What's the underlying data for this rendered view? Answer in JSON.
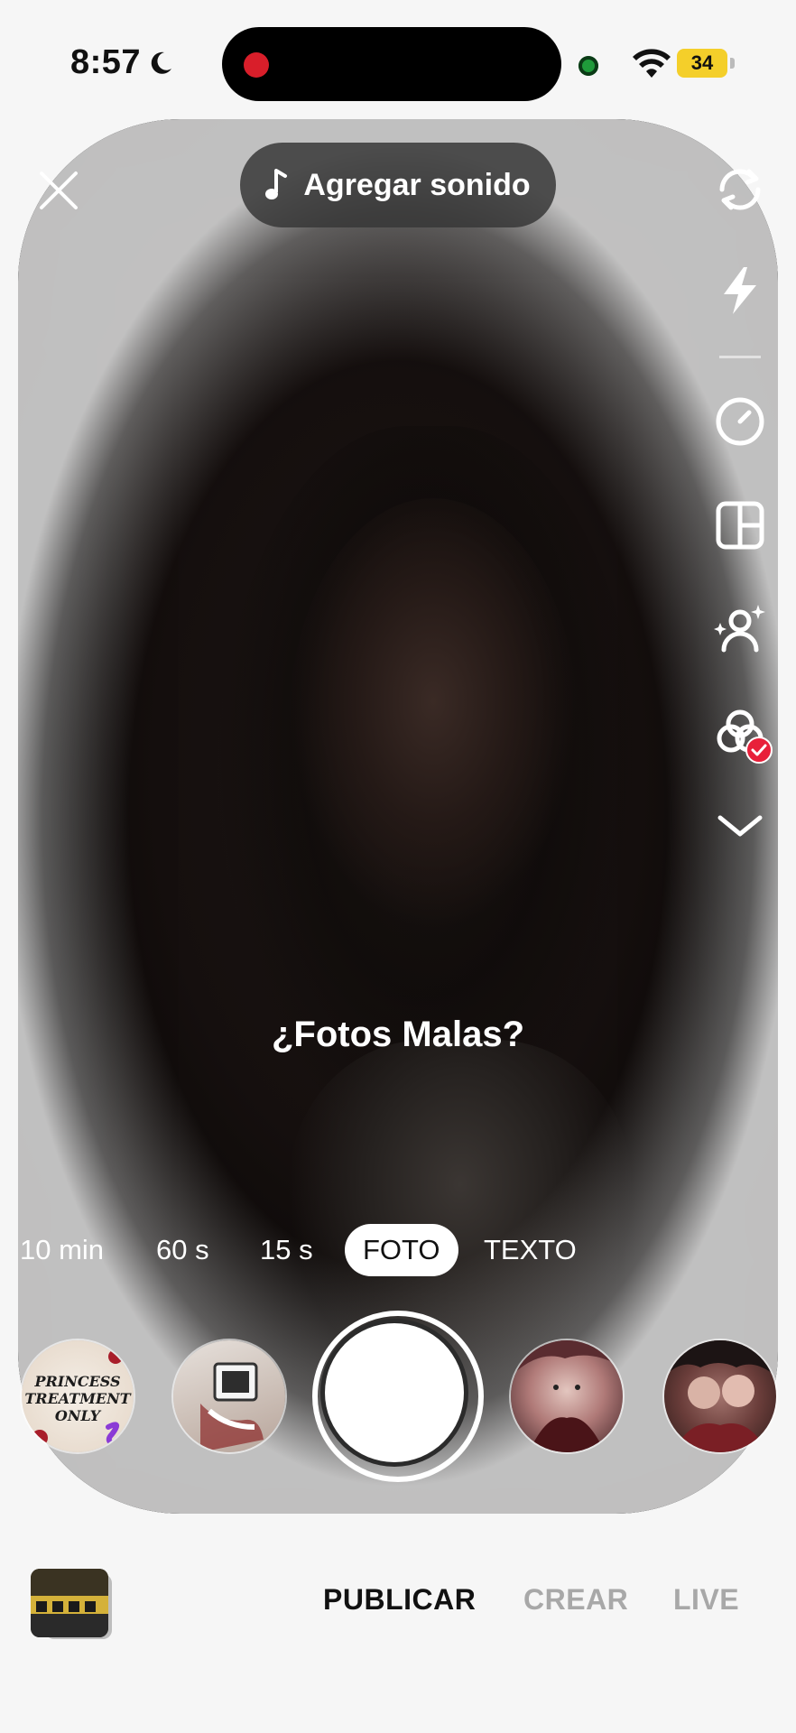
{
  "status_bar": {
    "time": "8:57",
    "battery": "34"
  },
  "top_bar": {
    "add_sound_label": "Agregar sonido"
  },
  "side_tools": [
    {
      "name": "flip-camera-icon"
    },
    {
      "name": "flash-icon"
    },
    {
      "name": "timer-icon"
    },
    {
      "name": "layout-icon"
    },
    {
      "name": "beauty-icon"
    },
    {
      "name": "filters-icon"
    },
    {
      "name": "chevron-down-icon"
    }
  ],
  "camera": {
    "caption": "¿Fotos Malas?"
  },
  "modes": {
    "items": [
      "10 min",
      "60 s",
      "15 s",
      "FOTO",
      "TEXTO"
    ],
    "active": "FOTO"
  },
  "effects": {
    "first_label": "PRINCESS TREATMENT ONLY"
  },
  "bottom_tabs": {
    "items": [
      "PUBLICAR",
      "CREAR",
      "LIVE"
    ],
    "active": "PUBLICAR"
  },
  "colors": {
    "accent_red": "#e8203a",
    "recording_dot": "#d91e2a",
    "battery_yellow": "#f4cf2a"
  }
}
